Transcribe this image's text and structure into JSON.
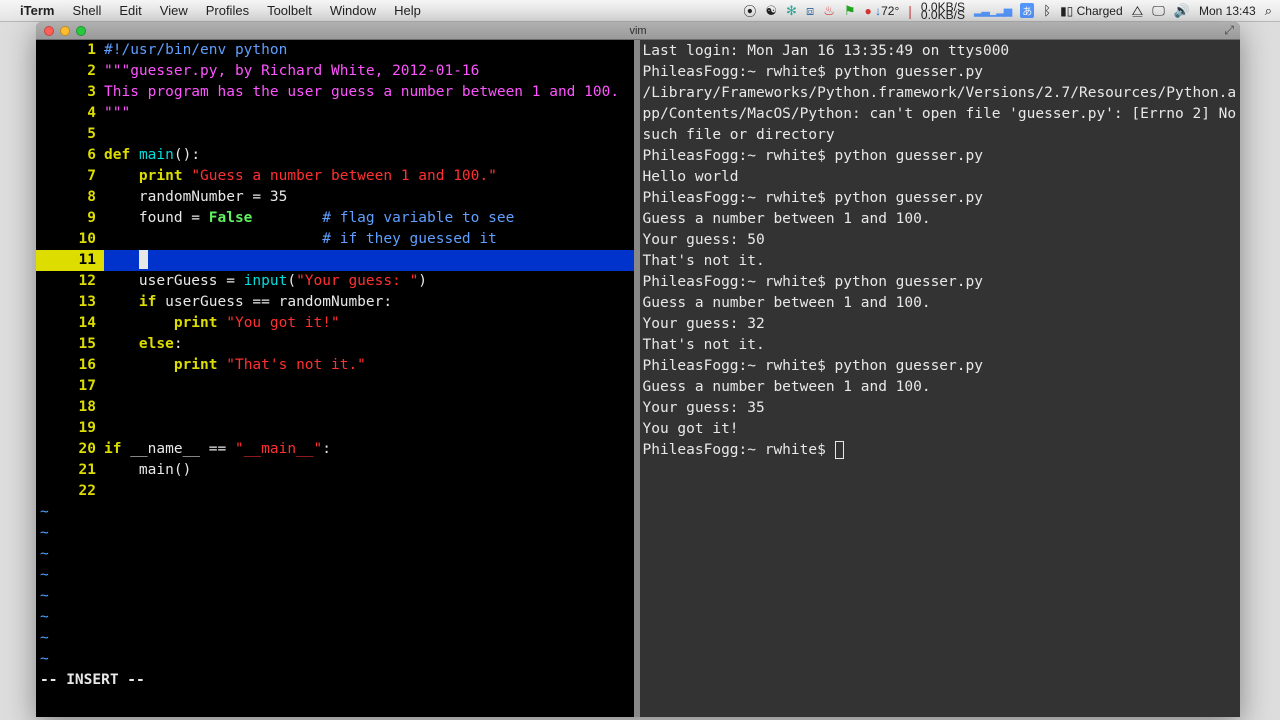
{
  "menubar": {
    "app": "iTerm",
    "items": [
      "Shell",
      "Edit",
      "View",
      "Profiles",
      "Toolbelt",
      "Window",
      "Help"
    ],
    "right": {
      "temp": "72°",
      "kbps_up": "0.0KB/S",
      "kbps_dn": "0.0KB/S",
      "batt": "Charged",
      "clock": "Mon 13:43"
    }
  },
  "window": {
    "title": "vim"
  },
  "vim": {
    "lines": [
      {
        "n": "1",
        "seg": [
          {
            "c": "c-sh",
            "t": "#!/usr/bin/env python"
          }
        ]
      },
      {
        "n": "2",
        "seg": [
          {
            "c": "c-com",
            "t": "\"\"\"guesser.py, by Richard White, 2012-01-16"
          }
        ]
      },
      {
        "n": "3",
        "seg": [
          {
            "c": "c-com",
            "t": "This program has the user guess a number between 1 and 100."
          }
        ]
      },
      {
        "n": "4",
        "seg": [
          {
            "c": "c-com",
            "t": "\"\"\""
          }
        ]
      },
      {
        "n": "5",
        "seg": []
      },
      {
        "n": "6",
        "seg": [
          {
            "c": "c-kw",
            "t": "def"
          },
          {
            "t": " "
          },
          {
            "c": "c-fn",
            "t": "main"
          },
          {
            "t": "():"
          }
        ]
      },
      {
        "n": "7",
        "seg": [
          {
            "t": "    "
          },
          {
            "c": "c-kw",
            "t": "print"
          },
          {
            "t": " "
          },
          {
            "c": "c-str",
            "t": "\"Guess a number between 1 and 100.\""
          }
        ]
      },
      {
        "n": "8",
        "seg": [
          {
            "t": "    randomNumber = 35"
          }
        ]
      },
      {
        "n": "9",
        "seg": [
          {
            "t": "    found = "
          },
          {
            "c": "c-bool",
            "t": "False"
          },
          {
            "t": "        "
          },
          {
            "c": "c-sh",
            "t": "# flag variable to see"
          }
        ]
      },
      {
        "n": "10",
        "seg": [
          {
            "t": "                         "
          },
          {
            "c": "c-sh",
            "t": "# if they guessed it"
          }
        ]
      },
      {
        "n": "11",
        "cur": true,
        "seg": [
          {
            "t": "    "
          }
        ]
      },
      {
        "n": "12",
        "seg": [
          {
            "t": "    userGuess = "
          },
          {
            "c": "c-fn",
            "t": "input"
          },
          {
            "t": "("
          },
          {
            "c": "c-str",
            "t": "\"Your guess: \""
          },
          {
            "t": ")"
          }
        ]
      },
      {
        "n": "13",
        "seg": [
          {
            "t": "    "
          },
          {
            "c": "c-kw",
            "t": "if"
          },
          {
            "t": " userGuess == randomNumber:"
          }
        ]
      },
      {
        "n": "14",
        "seg": [
          {
            "t": "        "
          },
          {
            "c": "c-kw",
            "t": "print"
          },
          {
            "t": " "
          },
          {
            "c": "c-str",
            "t": "\"You got it!\""
          }
        ]
      },
      {
        "n": "15",
        "seg": [
          {
            "t": "    "
          },
          {
            "c": "c-kw",
            "t": "else"
          },
          {
            "t": ":"
          }
        ]
      },
      {
        "n": "16",
        "seg": [
          {
            "t": "        "
          },
          {
            "c": "c-kw",
            "t": "print"
          },
          {
            "t": " "
          },
          {
            "c": "c-str",
            "t": "\"That's not it.\""
          }
        ]
      },
      {
        "n": "17",
        "seg": []
      },
      {
        "n": "18",
        "seg": []
      },
      {
        "n": "19",
        "seg": []
      },
      {
        "n": "20",
        "seg": [
          {
            "c": "c-kw",
            "t": "if"
          },
          {
            "t": " __name__ == "
          },
          {
            "c": "c-str",
            "t": "\"__main__\""
          },
          {
            "t": ":"
          }
        ]
      },
      {
        "n": "21",
        "seg": [
          {
            "t": "    main()"
          }
        ]
      },
      {
        "n": "22",
        "seg": []
      }
    ],
    "tildes": 8,
    "status": "-- INSERT --"
  },
  "shell": {
    "lines": [
      "Last login: Mon Jan 16 13:35:49 on ttys000",
      "PhileasFogg:~ rwhite$ python guesser.py",
      "/Library/Frameworks/Python.framework/Versions/2.7/Resources/Python.app/Contents/MacOS/Python: can't open file 'guesser.py': [Errno 2] No such file or directory",
      "PhileasFogg:~ rwhite$ python guesser.py",
      "Hello world",
      "PhileasFogg:~ rwhite$ python guesser.py",
      "Guess a number between 1 and 100.",
      "Your guess: 50",
      "That's not it.",
      "PhileasFogg:~ rwhite$ python guesser.py",
      "Guess a number between 1 and 100.",
      "Your guess: 32",
      "That's not it.",
      "PhileasFogg:~ rwhite$ python guesser.py",
      "Guess a number between 1 and 100.",
      "Your guess: 35",
      "You got it!"
    ],
    "prompt": "PhileasFogg:~ rwhite$ "
  }
}
